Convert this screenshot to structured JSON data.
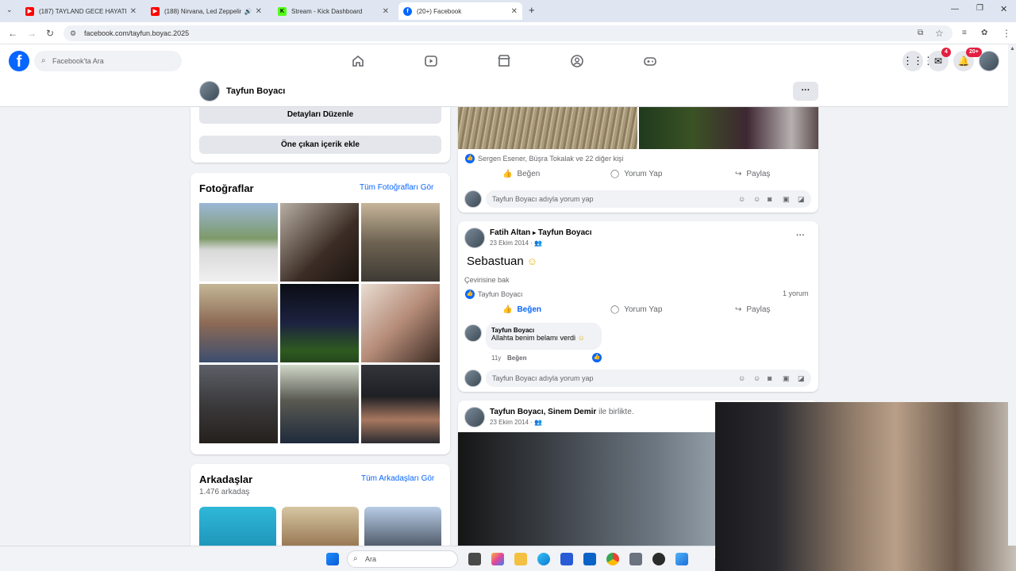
{
  "browser": {
    "tabs": [
      {
        "title": "(187) TAYLAND GECE HAYATI -",
        "favicon_color": "#ff0000"
      },
      {
        "title": "(188) Nirvana, Led Zeppelin",
        "favicon_color": "#ff0000"
      },
      {
        "title": "Stream - Kick Dashboard",
        "favicon_color": "#53fc18"
      },
      {
        "title": "(20+) Facebook",
        "favicon_color": "#0866ff",
        "active": true
      }
    ],
    "url": "facebook.com/tayfun.boyac.2025"
  },
  "fb_header": {
    "logo": "f",
    "search_placeholder": "Facebook'ta Ara",
    "messenger_badge": "4",
    "notif_badge": "20+"
  },
  "profile": {
    "name": "Tayfun Boyacı",
    "more": "···"
  },
  "left": {
    "edit_details": "Detayları Düzenle",
    "add_featured": "Öne çıkan içerik ekle",
    "photos_title": "Fotoğraflar",
    "photos_link": "Tüm Fotoğrafları Gör",
    "friends_title": "Arkadaşlar",
    "friends_link": "Tüm Arkadaşları Gör",
    "friends_count": "1.476 arkadaş"
  },
  "post1": {
    "likers": "Sergen Esener, Büşra Tokalak ve 22 diğer kişi",
    "like": "Beğen",
    "comment": "Yorum Yap",
    "share": "Paylaş",
    "comment_placeholder": "Tayfun Boyacı adıyla yorum yap"
  },
  "post2": {
    "author": "Fatih Altan",
    "arrow": "▸",
    "target": "Tayfun Boyacı",
    "date": "23 Ekim 2014 ·",
    "text": "Sebastuan",
    "translate": "Çevirisine bak",
    "liker": "Tayfun Boyacı",
    "comment_count": "1 yorum",
    "like": "Beğen",
    "comment": "Yorum Yap",
    "share": "Paylaş",
    "reply_author": "Tayfun Boyacı",
    "reply_text": "Allahta benim belamı verdi",
    "reply_time": "11y",
    "reply_like": "Beğen",
    "comment_placeholder": "Tayfun Boyacı adıyla yorum yap"
  },
  "post3": {
    "author": "Tayfun Boyacı",
    "sep": ",",
    "with_name": "Sinem Demir",
    "with_text": "ile birlikte.",
    "date": "23 Ekim 2014 ·"
  },
  "taskbar": {
    "search_placeholder": "Ara"
  },
  "colors": {
    "fb_blue": "#0866ff",
    "badge_red": "#e41e3f",
    "bg": "#f0f2f5"
  }
}
